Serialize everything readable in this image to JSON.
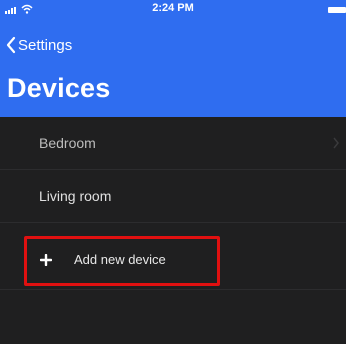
{
  "status_bar": {
    "time": "2:24 PM"
  },
  "nav": {
    "back_label": "Settings"
  },
  "page": {
    "title": "Devices"
  },
  "devices": [
    {
      "label": "Bedroom"
    },
    {
      "label": "Living room"
    }
  ],
  "add_device": {
    "label": "Add new device"
  },
  "colors": {
    "header_blue": "#2f6df0",
    "background": "#1f1f20",
    "highlight_red": "#e01010"
  }
}
